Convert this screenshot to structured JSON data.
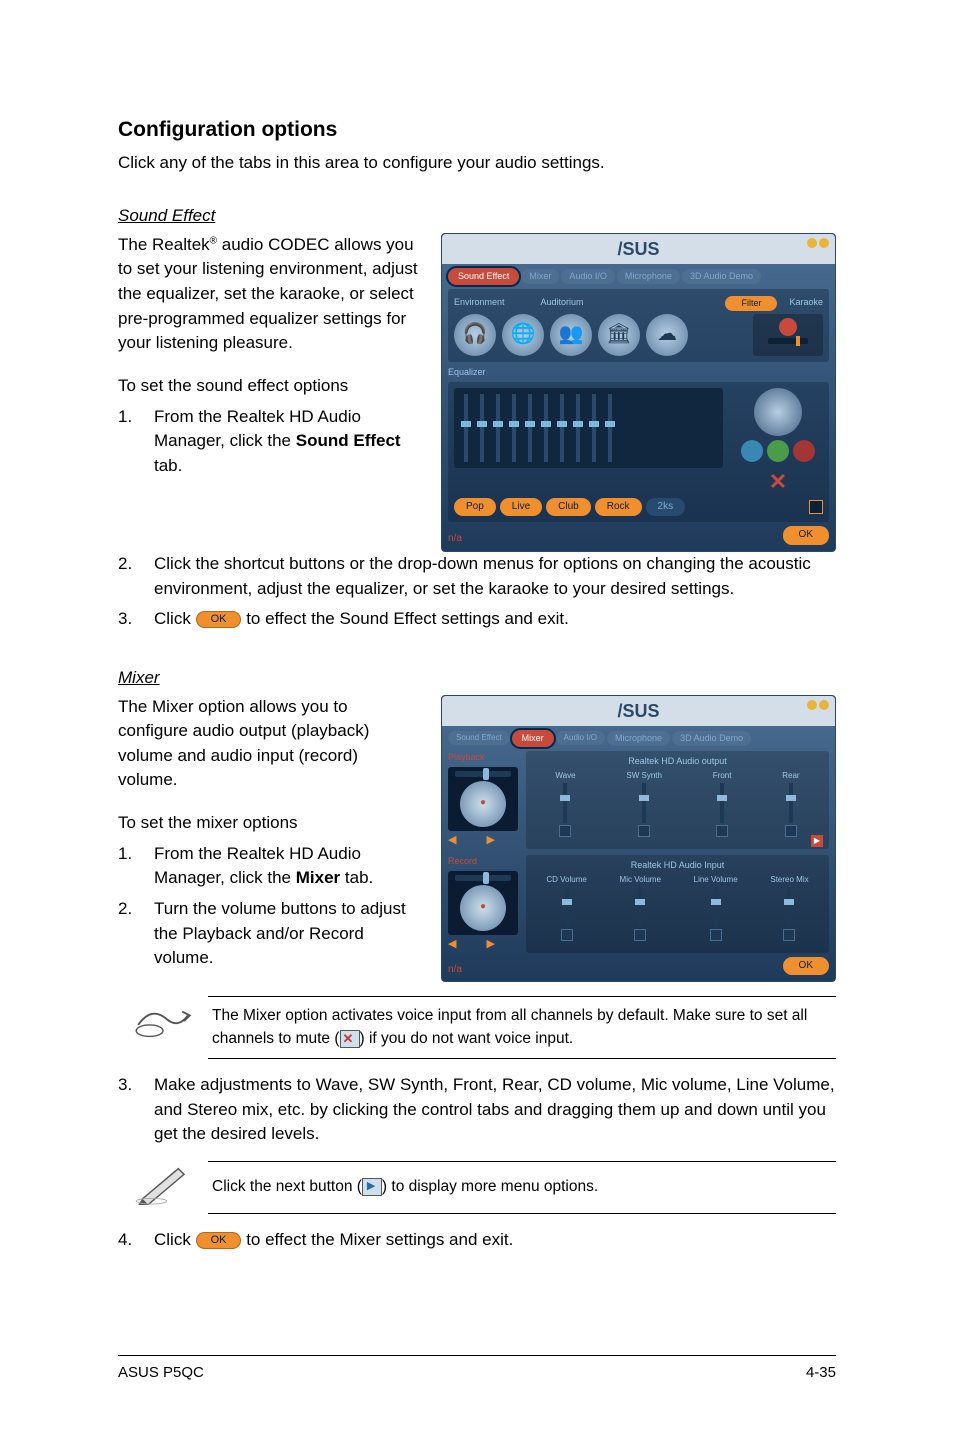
{
  "headings": {
    "config_options": "Configuration options",
    "sound_effect": "Sound Effect",
    "mixer": "Mixer"
  },
  "intro": {
    "config_options_text": "Click any of the tabs in this area to configure your audio settings."
  },
  "sound_effect": {
    "para1_pre": "The Realtek",
    "para1_sup": "®",
    "para1_post": " audio CODEC allows you to set your listening environment, adjust the equalizer, set the karaoke, or select pre-programmed equalizer settings for your listening pleasure.",
    "subhead": "To set the sound effect options",
    "steps": {
      "n1": "1.",
      "s1_pre": "From the Realtek HD Audio Manager, click the ",
      "s1_bold": "Sound Effect",
      "s1_post": " tab.",
      "n2": "2.",
      "s2": "Click the shortcut buttons or the drop-down menus for options on changing the acoustic environment, adjust the equalizer, or set the karaoke to your desired settings.",
      "n3": "3.",
      "s3_pre": "Click ",
      "s3_post": " to effect the Sound Effect settings and exit."
    }
  },
  "mixer": {
    "para1": "The Mixer option allows you to configure audio output (playback) volume and audio input (record) volume.",
    "subhead": "To set the mixer options",
    "steps": {
      "n1": "1.",
      "s1_pre": "From the Realtek HD Audio Manager, click the ",
      "s1_bold": "Mixer",
      "s1_post": " tab.",
      "n2": "2.",
      "s2": "Turn the volume buttons to adjust the Playback and/or Record volume.",
      "n3": "3.",
      "s3": "Make adjustments to Wave, SW Synth, Front, Rear, CD volume, Mic volume, Line Volume, and Stereo mix, etc. by clicking the control tabs and dragging them up and down until you get the desired levels.",
      "n4": "4.",
      "s4_pre": "Click ",
      "s4_post": " to effect the Mixer settings and exit."
    }
  },
  "notes": {
    "mute_pre": "The Mixer option activates voice input from all channels by default. Make sure to set all channels to mute (",
    "mute_post": ") if you do not want voice input.",
    "next_pre": "Click the next button (",
    "next_post": ") to display more menu options."
  },
  "ok_label": "OK",
  "panel": {
    "logo": "/SUS",
    "tabs": {
      "sound_effect": "Sound Effect",
      "mixer": "Mixer",
      "audio_io": "Audio I/O",
      "microphone": "Microphone",
      "audio_demo": "3D Audio Demo"
    },
    "filter_label": "Filter",
    "environment_label": "Environment",
    "auditorium_label": "Auditorium",
    "karaoke_label": "Karaoke",
    "equalizer_label": "Equalizer",
    "presets": [
      "Pop",
      "Live",
      "Club",
      "Rock",
      "2ks"
    ],
    "playback_label": "Playback",
    "record_label": "Record",
    "realtek_output": "Realtek HD Audio output",
    "realtek_input": "Realtek HD Audio Input",
    "cols_out": [
      "Wave",
      "SW Synth",
      "Front",
      "Rear"
    ],
    "cols_in": [
      "CD Volume",
      "Mic Volume",
      "Line Volume",
      "Stereo Mix"
    ],
    "left_tag": "n/a"
  },
  "footer": {
    "left": "ASUS P5QC",
    "right": "4-35"
  }
}
